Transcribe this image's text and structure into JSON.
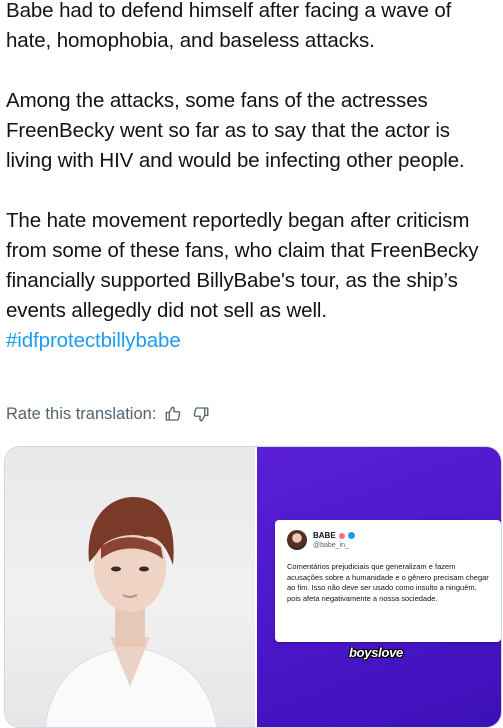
{
  "tweet": {
    "paragraph1": "Babe had to defend himself after facing a wave of hate, homophobia, and baseless attacks.",
    "paragraph2": "Among the attacks, some fans of the actresses FreenBecky went so far as to say that the actor is living with HIV and would be infecting other people.",
    "paragraph3": "The hate movement reportedly began after criticism from some of these fans, who claim that FreenBecky financially supported BillyBabe's tour, as the ship’s events allegedly did not sell as well.",
    "hashtag": "#idfprotectbillybabe"
  },
  "translation": {
    "rate_label": "Rate this translation:",
    "thumbs_up_icon": "thumbs-up-icon",
    "thumbs_down_icon": "thumbs-down-icon"
  },
  "media": {
    "card": {
      "name": "BABE",
      "handle": "@babe_in_",
      "text": "Comentários prejudiciais que generalizam e fazem acusações sobre a humanidade e o gênero precisam chegar ao fim. Isso não deve ser usado como insulto a ninguém, pois afeta negativamente a nossa sociedade."
    },
    "watermark": "boyslove"
  },
  "colors": {
    "link": "#1d9bf0",
    "muted": "#536471",
    "purple_bg": "#4d18cc"
  }
}
